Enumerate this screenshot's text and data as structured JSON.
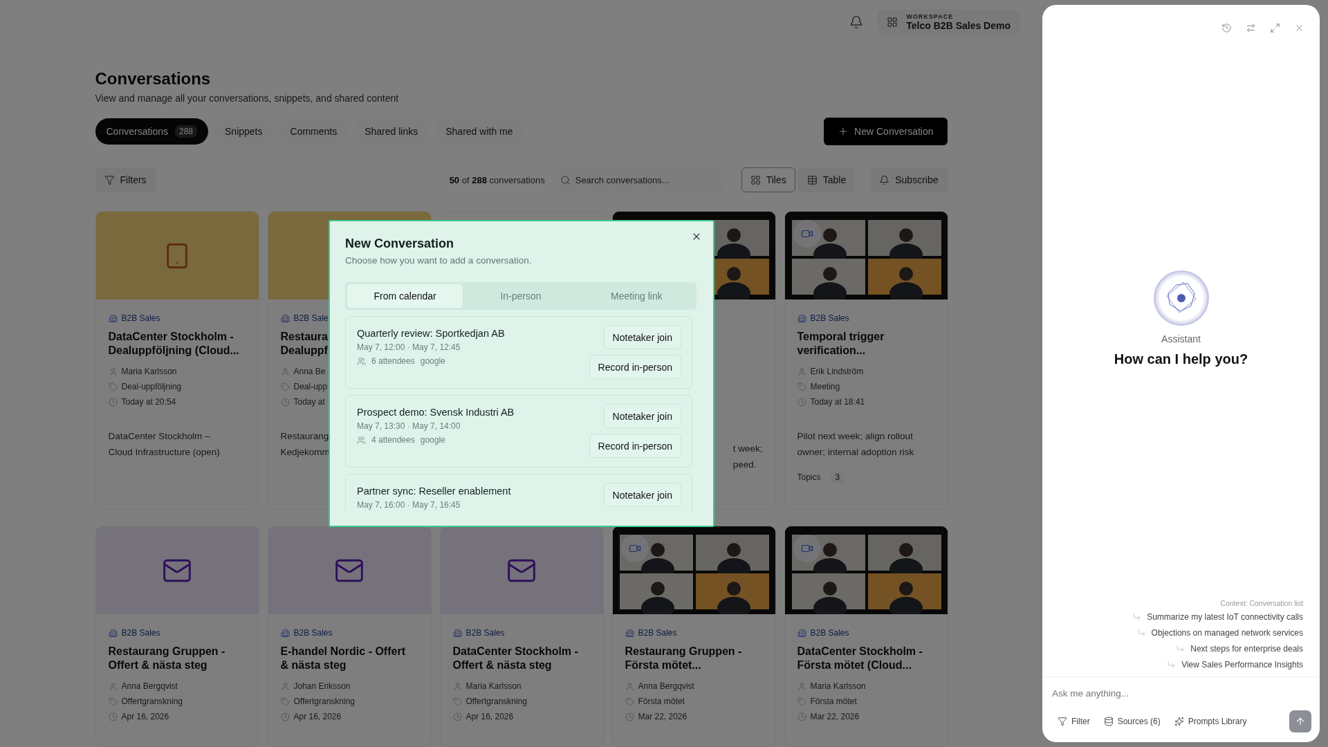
{
  "workspace": {
    "label": "WORKSPACE",
    "name": "Telco B2B Sales Demo"
  },
  "page": {
    "title": "Conversations",
    "subtitle": "View and manage all your conversations, snippets, and shared content"
  },
  "tabs": [
    {
      "label": "Conversations",
      "count": "288",
      "selected": true
    },
    {
      "label": "Snippets",
      "selected": false
    },
    {
      "label": "Comments",
      "selected": false
    },
    {
      "label": "Shared links",
      "selected": false
    },
    {
      "label": "Shared with me",
      "selected": false
    }
  ],
  "new_button": "New Conversation",
  "toolbar": {
    "filters": "Filters",
    "count": "**50** of **288** conversations",
    "search_placeholder": "Search conversations...",
    "views": [
      {
        "kind": "tiles",
        "label": "Tiles",
        "selected": true
      },
      {
        "kind": "table",
        "label": "Table",
        "selected": false
      }
    ],
    "subscribe": "Subscribe"
  },
  "cards": [
    {
      "kind": "full",
      "media": {
        "kind": "tablet"
      },
      "category": "B2B Sales",
      "title_lines": [
        "DataCenter Stockholm -",
        "Dealuppföljning (Cloud..."
      ],
      "person": "Maria Karlsson",
      "tag": "Deal-uppföljning",
      "time": "Today at 20:54",
      "description_lines": [
        "DataCenter Stockholm –",
        "Cloud Infrastructure (open)"
      ]
    },
    {
      "kind": "full",
      "media": {
        "kind": "tablet"
      },
      "category": "B2B Sale",
      "title_lines": [
        "Restaura",
        "Dealuppf"
      ],
      "person": "Anna Be",
      "tag": "Deal-upp",
      "time": "Today at",
      "description_lines": [
        "Restaurang",
        "Kedjekomm"
      ]
    },
    {
      "kind": "covered"
    },
    {
      "kind": "tail",
      "media": {
        "kind": "video",
        "badge": false
      },
      "description_lines": [
        "t week;",
        "peed."
      ]
    },
    {
      "kind": "full",
      "media": {
        "kind": "video",
        "badge": true
      },
      "category": "B2B Sales",
      "title_lines": [
        "Temporal trigger",
        "verification..."
      ],
      "person": "Erik Lindström",
      "tag": "Meeting",
      "time": "Today at 18:41",
      "description_lines": [
        "Pilot next week; align rollout",
        "owner; internal adoption risk"
      ],
      "topics": {
        "label": "Topics",
        "count": "3"
      }
    },
    {
      "kind": "full",
      "media": {
        "kind": "mail"
      },
      "category": "B2B Sales",
      "title_lines": [
        "Restaurang Gruppen -",
        "Offert & nästa steg"
      ],
      "person": "Anna Bergqvist",
      "tag": "Offertgranskning",
      "time": "Apr 16, 2026"
    },
    {
      "kind": "full",
      "media": {
        "kind": "mail"
      },
      "category": "B2B Sales",
      "title_lines": [
        "E-handel Nordic - Offert",
        "& nästa steg"
      ],
      "person": "Johan Eriksson",
      "tag": "Offertgranskning",
      "time": "Apr 16, 2026"
    },
    {
      "kind": "full",
      "media": {
        "kind": "mail"
      },
      "category": "B2B Sales",
      "title_lines": [
        "DataCenter Stockholm -",
        "Offert & nästa steg"
      ],
      "person": "Maria Karlsson",
      "tag": "Offertgranskning",
      "time": "Apr 16, 2026"
    },
    {
      "kind": "full",
      "media": {
        "kind": "video",
        "badge": true
      },
      "category": "B2B Sales",
      "title_lines": [
        "Restaurang Gruppen -",
        "Första mötet..."
      ],
      "person": "Anna Bergqvist",
      "tag": "Första mötet",
      "time": "Mar 22, 2026"
    },
    {
      "kind": "full",
      "media": {
        "kind": "video",
        "badge": true
      },
      "category": "B2B Sales",
      "title_lines": [
        "DataCenter Stockholm -",
        "Första mötet (Cloud..."
      ],
      "person": "Maria Karlsson",
      "tag": "Första mötet",
      "time": "Mar 22, 2026"
    }
  ],
  "modal": {
    "title": "New Conversation",
    "subtitle": "Choose how you want to add a conversation.",
    "tabs": [
      {
        "label": "From calendar",
        "selected": true
      },
      {
        "label": "In-person",
        "selected": false
      },
      {
        "label": "Meeting link",
        "selected": false
      }
    ],
    "events": [
      {
        "title": "Quarterly review: Sportkedjan AB",
        "time": "May 7, 12:00 · May 7, 12:45",
        "attendees": "6 attendees",
        "source": "google",
        "buttons": [
          "Notetaker join",
          "Record in-person"
        ]
      },
      {
        "title": "Prospect demo: Svensk Industri AB",
        "time": "May 7, 13:30 · May 7, 14:00",
        "attendees": "4 attendees",
        "source": "google",
        "buttons": [
          "Notetaker join",
          "Record in-person"
        ]
      },
      {
        "title": "Partner sync: Reseller enablement",
        "time": "May 7, 16:00 · May 7, 16:45",
        "buttons": [
          "Notetaker join"
        ]
      }
    ]
  },
  "assistant": {
    "name": "Assistant",
    "greeting": "How can I help you?",
    "context": "Context: Conversation list",
    "suggestions": [
      "Summarize my latest IoT connectivity calls",
      "Objections on managed network services",
      "Next steps for enterprise deals",
      "View Sales Performance Insights"
    ],
    "input_placeholder": "Ask me anything...",
    "actions": [
      {
        "kind": "filter",
        "label": "Filter"
      },
      {
        "kind": "sources",
        "label": "Sources (6)"
      },
      {
        "kind": "prompts",
        "label": "Prompts Library"
      }
    ]
  }
}
